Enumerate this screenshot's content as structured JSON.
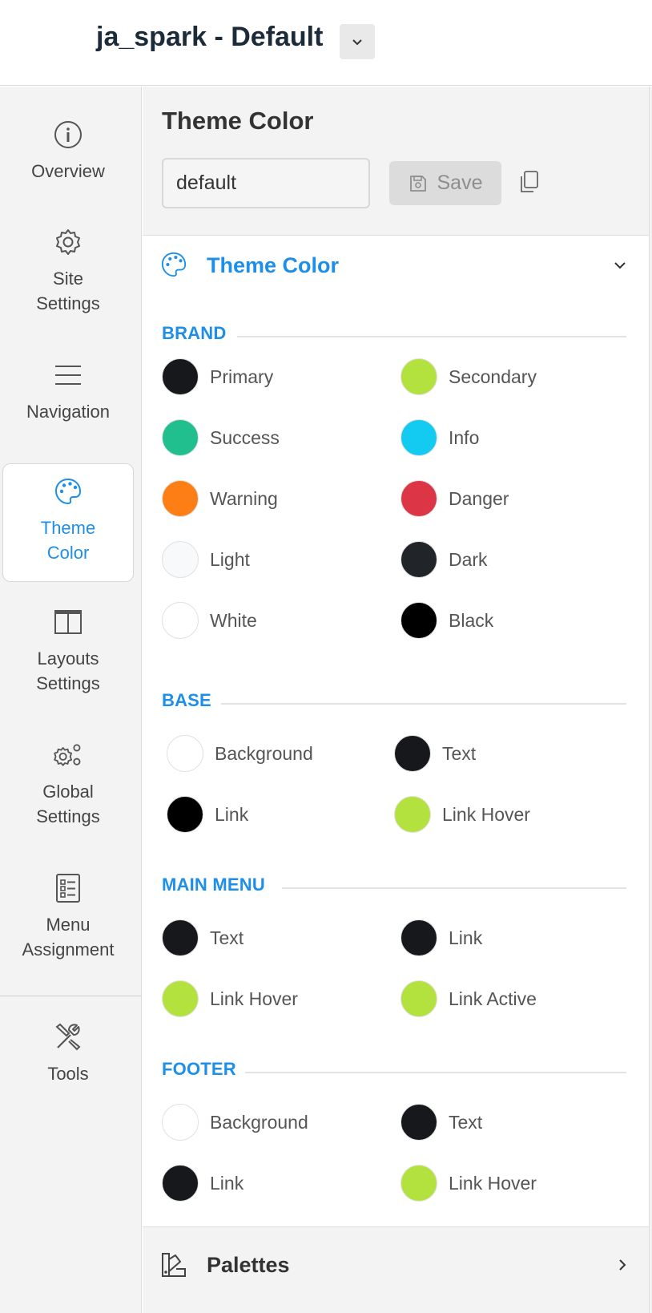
{
  "header": {
    "site_title": "ja_spark - Default"
  },
  "sidebar": {
    "items": [
      {
        "label": "Overview",
        "icon": "info-icon",
        "active": false
      },
      {
        "label": "Site\nSettings",
        "icon": "gear-icon",
        "active": false
      },
      {
        "label": "Navigation",
        "icon": "menu-icon",
        "active": false
      },
      {
        "label": "Theme\nColor",
        "icon": "palette-icon",
        "active": true
      },
      {
        "label": "Layouts\nSettings",
        "icon": "layout-icon",
        "active": false
      },
      {
        "label": "Global\nSettings",
        "icon": "gears-icon",
        "active": false
      },
      {
        "label": "Menu\nAssignment",
        "icon": "checklist-icon",
        "active": false
      },
      {
        "label": "Tools",
        "icon": "tools-icon",
        "active": false
      }
    ]
  },
  "main": {
    "title": "Theme Color",
    "theme_name_value": "default",
    "save_label": "Save",
    "section_title": "Theme Color",
    "palettes_title": "Palettes"
  },
  "groups": {
    "brand": {
      "title": "BRAND",
      "swatches": [
        {
          "label": "Primary",
          "color": "#17181b"
        },
        {
          "label": "Secondary",
          "color": "#b3e23f"
        },
        {
          "label": "Success",
          "color": "#20bf8d"
        },
        {
          "label": "Info",
          "color": "#13caf0"
        },
        {
          "label": "Warning",
          "color": "#fd7e14"
        },
        {
          "label": "Danger",
          "color": "#dc3545"
        },
        {
          "label": "Light",
          "color": "#f8f9fa"
        },
        {
          "label": "Dark",
          "color": "#212529"
        },
        {
          "label": "White",
          "color": "#ffffff"
        },
        {
          "label": "Black",
          "color": "#000000"
        }
      ]
    },
    "base": {
      "title": "BASE",
      "swatches": [
        {
          "label": "Background",
          "color": "#ffffff"
        },
        {
          "label": "Text",
          "color": "#17181b"
        },
        {
          "label": "Link",
          "color": "#000000"
        },
        {
          "label": "Link Hover",
          "color": "#b3e23f"
        }
      ]
    },
    "main_menu": {
      "title": "MAIN MENU",
      "swatches": [
        {
          "label": "Text",
          "color": "#17181b"
        },
        {
          "label": "Link",
          "color": "#17181b"
        },
        {
          "label": "Link Hover",
          "color": "#b3e23f"
        },
        {
          "label": "Link Active",
          "color": "#b3e23f"
        }
      ]
    },
    "footer": {
      "title": "FOOTER",
      "swatches": [
        {
          "label": "Background",
          "color": "#ffffff"
        },
        {
          "label": "Text",
          "color": "#17181b"
        },
        {
          "label": "Link",
          "color": "#17181b"
        },
        {
          "label": "Link Hover",
          "color": "#b3e23f"
        }
      ]
    }
  },
  "colors": {
    "accent": "#1d8fe8",
    "sidebar_bg": "#f3f3f3"
  }
}
